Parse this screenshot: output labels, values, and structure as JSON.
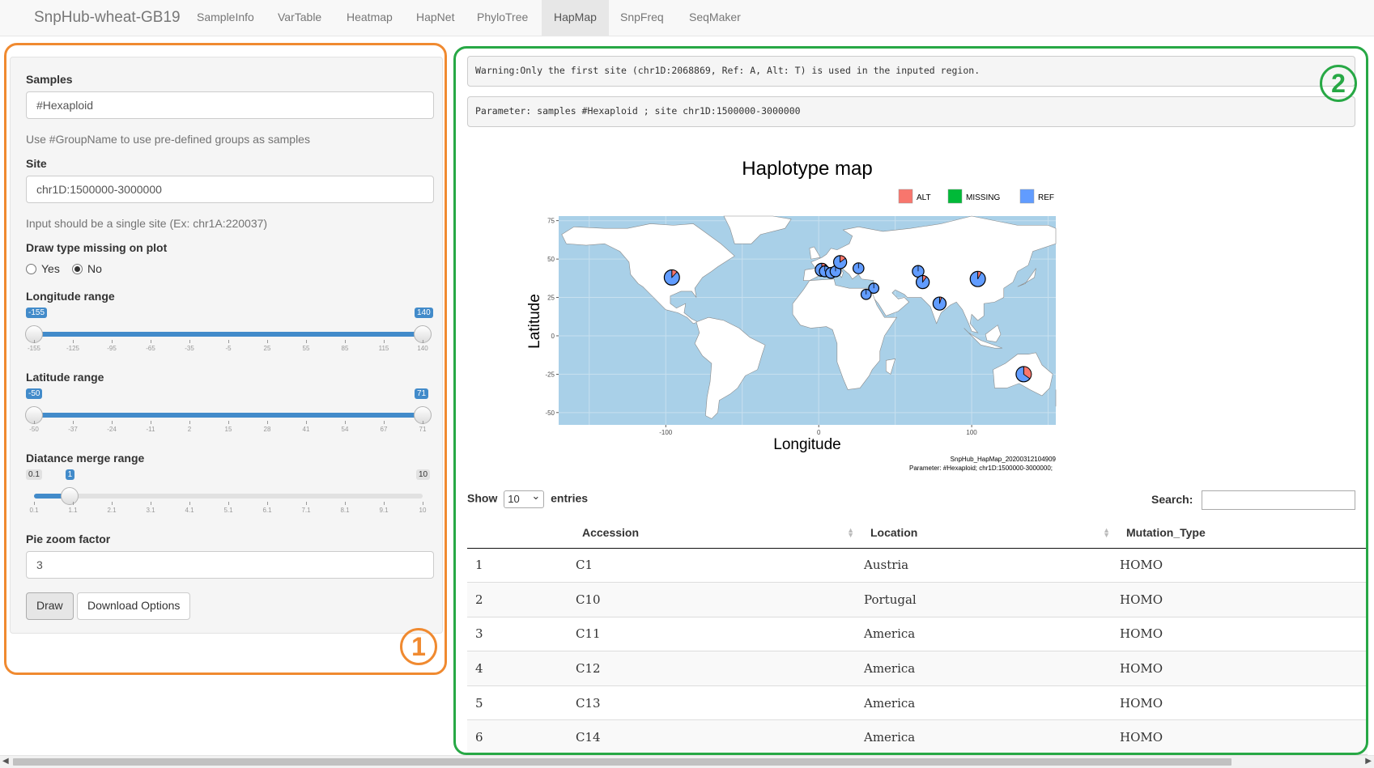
{
  "navbar": {
    "brand": "SnpHub-wheat-GB19",
    "items": [
      {
        "label": "SampleInfo",
        "active": false
      },
      {
        "label": "VarTable",
        "active": false
      },
      {
        "label": "Heatmap",
        "active": false
      },
      {
        "label": "HapNet",
        "active": false
      },
      {
        "label": "PhyloTree",
        "active": false
      },
      {
        "label": "HapMap",
        "active": true
      },
      {
        "label": "SnpFreq",
        "active": false
      },
      {
        "label": "SeqMaker",
        "active": false
      }
    ]
  },
  "annotations": {
    "panel1": "1",
    "panel2": "2"
  },
  "sidebar": {
    "samples_label": "Samples",
    "samples_value": "#Hexaploid",
    "samples_help": "Use #GroupName to use pre-defined groups as samples",
    "site_label": "Site",
    "site_value": "chr1D:1500000-3000000",
    "site_help": "Input should be a single site (Ex: chr1A:220037)",
    "missing_label": "Draw type missing on plot",
    "missing_options": [
      {
        "label": "Yes",
        "checked": false
      },
      {
        "label": "No",
        "checked": true
      }
    ],
    "lon_label": "Longitude range",
    "lon": {
      "min": -155,
      "max": 140,
      "from": -155,
      "to": 140,
      "from_label": "-155",
      "to_label": "140",
      "ticks": [
        "-155",
        "-125",
        "-95",
        "-65",
        "-35",
        "-5",
        "25",
        "55",
        "85",
        "115",
        "140"
      ]
    },
    "lat_label": "Latitude range",
    "lat": {
      "min": -50,
      "max": 71,
      "from": -50,
      "to": 71,
      "from_label": "-50",
      "to_label": "71",
      "ticks": [
        "-50",
        "-37",
        "-24",
        "-11",
        "2",
        "15",
        "28",
        "41",
        "54",
        "67",
        "71"
      ]
    },
    "merge_label": "Diatance merge range",
    "merge": {
      "min": 0.1,
      "max": 10,
      "value": 1,
      "min_label": "0.1",
      "value_label": "1",
      "max_label": "10",
      "ticks": [
        "0.1",
        "1.1",
        "2.1",
        "3.1",
        "4.1",
        "5.1",
        "6.1",
        "7.1",
        "8.1",
        "9.1",
        "10"
      ]
    },
    "zoom_label": "Pie zoom factor",
    "zoom_value": "3",
    "draw_button": "Draw",
    "download_button": "Download Options"
  },
  "main": {
    "warning": "Warning:Only the first site (chr1D:2068869, Ref: A, Alt: T) is used in the inputed region.",
    "parameter": "Parameter: samples #Hexaploid ; site chr1D:1500000-3000000"
  },
  "plot": {
    "title": "Haplotype map",
    "xlabel": "Longitude",
    "ylabel": "Latitude",
    "legend": [
      {
        "label": "ALT",
        "color": "#f8766d"
      },
      {
        "label": "MISSING",
        "color": "#00ba38"
      },
      {
        "label": "REF",
        "color": "#619cff"
      }
    ],
    "x_ticks": [
      "-100",
      "0",
      "100"
    ],
    "y_ticks": [
      "75",
      "50",
      "25",
      "0",
      "-25",
      "-50"
    ],
    "footer_line1": "SnpHub_HapMap_20200312104909",
    "footer_line2": "Parameter: #Hexaploid; chr1D:1500000-3000000;",
    "ocean_color": "#a9d0e8",
    "land_color": "#ffffff"
  },
  "chart_data": {
    "type": "scatter",
    "title": "Haplotype map",
    "xlabel": "Longitude",
    "ylabel": "Latitude",
    "xlim": [
      -170,
      155
    ],
    "ylim": [
      -58,
      78
    ],
    "series": [
      {
        "name": "ALT",
        "color": "#f8766d"
      },
      {
        "name": "MISSING",
        "color": "#00ba38"
      },
      {
        "name": "REF",
        "color": "#619cff"
      }
    ],
    "points": [
      {
        "lon": -96,
        "lat": 38,
        "alt": 0.12,
        "size": 1.2
      },
      {
        "lon": 2,
        "lat": 43,
        "alt": 0.1,
        "size": 0.9
      },
      {
        "lon": 4,
        "lat": 42,
        "alt": 0.0,
        "size": 0.6
      },
      {
        "lon": 8,
        "lat": 41,
        "alt": 0.0,
        "size": 0.6
      },
      {
        "lon": 11,
        "lat": 42,
        "alt": 0.0,
        "size": 0.6
      },
      {
        "lon": 14,
        "lat": 48,
        "alt": 0.15,
        "size": 0.9
      },
      {
        "lon": 26,
        "lat": 44,
        "alt": 0.0,
        "size": 0.6
      },
      {
        "lon": 36,
        "lat": 31,
        "alt": 0.0,
        "size": 0.5
      },
      {
        "lon": 31,
        "lat": 27,
        "alt": 0.0,
        "size": 0.5
      },
      {
        "lon": 65,
        "lat": 42,
        "alt": 0.0,
        "size": 0.7
      },
      {
        "lon": 68,
        "lat": 35,
        "alt": 0.1,
        "size": 0.9
      },
      {
        "lon": 79,
        "lat": 21,
        "alt": 0.05,
        "size": 0.9
      },
      {
        "lon": 104,
        "lat": 37,
        "alt": 0.08,
        "size": 1.2
      },
      {
        "lon": 134,
        "lat": -25,
        "alt": 0.35,
        "size": 1.2
      }
    ]
  },
  "table": {
    "show_label": "Show",
    "entries_value": "10",
    "entries_label": "entries",
    "search_label": "Search:",
    "columns": [
      "",
      "Accession",
      "Location",
      "Mutation_Type"
    ],
    "rows": [
      [
        "1",
        "C1",
        "Austria",
        "HOMO"
      ],
      [
        "2",
        "C10",
        "Portugal",
        "HOMO"
      ],
      [
        "3",
        "C11",
        "America",
        "HOMO"
      ],
      [
        "4",
        "C12",
        "America",
        "HOMO"
      ],
      [
        "5",
        "C13",
        "America",
        "HOMO"
      ],
      [
        "6",
        "C14",
        "America",
        "HOMO"
      ]
    ]
  }
}
